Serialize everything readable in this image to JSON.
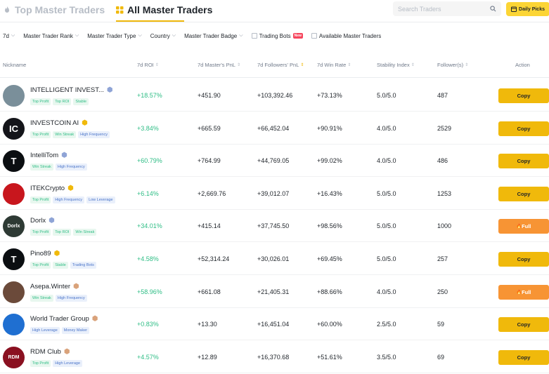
{
  "tabs": {
    "top_label": "Top Master Traders",
    "all_label": "All Master Traders"
  },
  "search": {
    "placeholder": "Search Traders"
  },
  "daily_picks_label": "Daily Picks",
  "filters": {
    "period": "7d",
    "rank": "Master Trader Rank",
    "type": "Master Trader Type",
    "country": "Country",
    "badge": "Master Trader Badge",
    "trading_bots": "Trading Bots",
    "new_badge": "New",
    "available": "Available Master Traders"
  },
  "columns": {
    "nickname": "Nickname",
    "roi": "7d ROI",
    "master_pnl": "7d Master's PnL",
    "followers_pnl": "7d Followers' PnL",
    "win_rate": "7d Win Rate",
    "stability": "Stability Index",
    "followers": "Follower(s)",
    "action": "Action"
  },
  "traders": [
    {
      "name": "INTELLIGENT INVEST...",
      "tags": [
        "Top Profit",
        "Top ROI",
        "Stable"
      ],
      "roi": "+18.57%",
      "master_pnl": "+451.90",
      "followers_pnl": "+103,392.46",
      "win_rate": "+73.13%",
      "stability": "5.0/5.0",
      "followers": "487",
      "action": "Copy",
      "avatar_text": "",
      "avatar_color": "#7a8f9a",
      "badge_icon": "diamond"
    },
    {
      "name": "INVESTCOIN AI",
      "tags": [
        "Top Profit",
        "Win Streak",
        "High Frequency"
      ],
      "roi": "+3.84%",
      "master_pnl": "+665.59",
      "followers_pnl": "+66,452.04",
      "win_rate": "+90.91%",
      "stability": "4.0/5.0",
      "followers": "2529",
      "action": "Copy",
      "avatar_text": "IC",
      "avatar_color": "#14151a",
      "badge_icon": "gold"
    },
    {
      "name": "IntelliTom",
      "tags": [
        "Win Streak",
        "High Frequency"
      ],
      "roi": "+60.79%",
      "master_pnl": "+764.99",
      "followers_pnl": "+44,769.05",
      "win_rate": "+99.02%",
      "stability": "4.0/5.0",
      "followers": "486",
      "action": "Copy",
      "avatar_text": "T",
      "avatar_color": "#0b0e11",
      "badge_icon": "diamond"
    },
    {
      "name": "ITEKCrypto",
      "tags": [
        "Top Profit",
        "High Frequency",
        "Low Leverage"
      ],
      "roi": "+6.14%",
      "master_pnl": "+2,669.76",
      "followers_pnl": "+39,012.07",
      "win_rate": "+16.43%",
      "stability": "5.0/5.0",
      "followers": "1253",
      "action": "Copy",
      "avatar_text": "",
      "avatar_color": "#c8161d",
      "badge_icon": "gold"
    },
    {
      "name": "Dorlx",
      "tags": [
        "Top Profit",
        "Top ROI",
        "Win Streak"
      ],
      "roi": "+34.01%",
      "master_pnl": "+415.14",
      "followers_pnl": "+37,745.50",
      "win_rate": "+98.56%",
      "stability": "5.0/5.0",
      "followers": "1000",
      "action": "Full",
      "avatar_text": "Dorlx",
      "avatar_color": "#2e3a34",
      "badge_icon": "diamond"
    },
    {
      "name": "Pino89",
      "tags": [
        "Top Profit",
        "Stable",
        "Trading Bots"
      ],
      "roi": "+4.58%",
      "master_pnl": "+52,314.24",
      "followers_pnl": "+30,026.01",
      "win_rate": "+69.45%",
      "stability": "5.0/5.0",
      "followers": "257",
      "action": "Copy",
      "avatar_text": "T",
      "avatar_color": "#0b0e11",
      "badge_icon": "gold"
    },
    {
      "name": "Asepa.Winter",
      "tags": [
        "Win Streak",
        "High Frequency"
      ],
      "roi": "+58.96%",
      "master_pnl": "+661.08",
      "followers_pnl": "+21,405.31",
      "win_rate": "+88.66%",
      "stability": "4.0/5.0",
      "followers": "250",
      "action": "Full",
      "avatar_text": "",
      "avatar_color": "#6b4a3a",
      "badge_icon": "bronze"
    },
    {
      "name": "World Trader Group",
      "tags": [
        "High Leverage",
        "Money Maker"
      ],
      "roi": "+0.83%",
      "master_pnl": "+13.30",
      "followers_pnl": "+16,451.04",
      "win_rate": "+60.00%",
      "stability": "2.5/5.0",
      "followers": "59",
      "action": "Copy",
      "avatar_text": "",
      "avatar_color": "#1f6fd1",
      "badge_icon": "bronze"
    },
    {
      "name": "RDM Club",
      "tags": [
        "Top Profit",
        "High Leverage"
      ],
      "roi": "+4.57%",
      "master_pnl": "+12.89",
      "followers_pnl": "+16,370.68",
      "win_rate": "+51.61%",
      "stability": "3.5/5.0",
      "followers": "69",
      "action": "Copy",
      "avatar_text": "RDM",
      "avatar_color": "#8a1020",
      "badge_icon": "bronze"
    }
  ],
  "colors": {
    "accent": "#f0b90b",
    "full": "#f79434",
    "positive": "#2ebd85"
  }
}
